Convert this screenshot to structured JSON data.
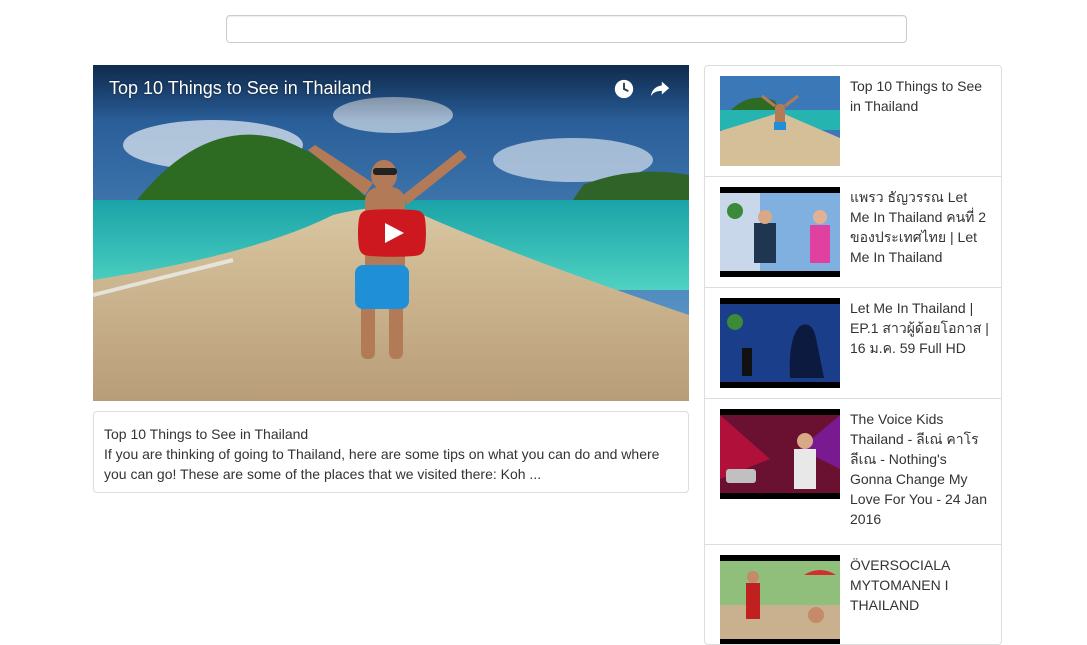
{
  "search": {
    "value": "",
    "placeholder": ""
  },
  "player": {
    "title": "Top 10 Things to See in Thailand",
    "icons": {
      "watch_later": "clock-icon",
      "share": "share-icon",
      "play": "play-icon"
    }
  },
  "description": {
    "title": "Top 10 Things to See in Thailand",
    "text": "If you are thinking of going to Thailand, here are some tips on what you can do and where you can go! These are some of the places that we visited there: Koh ..."
  },
  "related": [
    {
      "title": "Top 10 Things to See in Thailand"
    },
    {
      "title": "แพรว ธัญวรรณ Let Me In Thailand คนที่ 2 ของประเทศไทย | Let Me In Thailand"
    },
    {
      "title": "Let Me In Thailand | EP.1 สาวผู้ด้อยโอกาส | 16 ม.ค. 59 Full HD"
    },
    {
      "title": "The Voice Kids Thailand - ลีเณ่ คาโร ลีเณ - Nothing's Gonna Change My Love For You - 24 Jan 2016"
    },
    {
      "title": "ÖVERSOCIALA MYTOMANEN I THAILAND"
    }
  ],
  "colors": {
    "play_button": "#cc181e",
    "border": "#dddddd"
  }
}
